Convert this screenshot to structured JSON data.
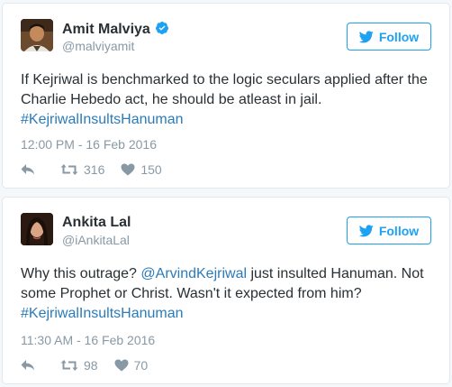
{
  "tweets": [
    {
      "name": "Amit Malviya",
      "verified": true,
      "handle": "@malviyamit",
      "follow_label": "Follow",
      "text_before": "If Kejriwal is benchmarked to the logic seculars applied after the Charlie Hebedo act, he should be atleast in jail. ",
      "mention": "",
      "text_after": "",
      "hashtag": "#KejriwalInsultsHanuman",
      "timestamp": "12:00 PM - 16 Feb 2016",
      "retweets": "316",
      "likes": "150"
    },
    {
      "name": "Ankita Lal",
      "verified": false,
      "handle": "@iAnkitaLal",
      "follow_label": "Follow",
      "text_before": "Why this outrage? ",
      "mention": "@ArvindKejriwal",
      "text_after": " just insulted Hanuman. Not some Prophet or Christ. Wasn't it expected from him? ",
      "hashtag": "#KejriwalInsultsHanuman",
      "timestamp": "11:30 AM - 16 Feb 2016",
      "retweets": "98",
      "likes": "70"
    }
  ],
  "colors": {
    "twitter_blue": "#1da1f2",
    "link": "#2b7bb9",
    "muted": "#8899a6",
    "text": "#292f33",
    "background": "#f5f8fa"
  },
  "icons": [
    "verified-badge-icon",
    "twitter-bird-icon",
    "reply-icon",
    "retweet-icon",
    "heart-icon"
  ]
}
